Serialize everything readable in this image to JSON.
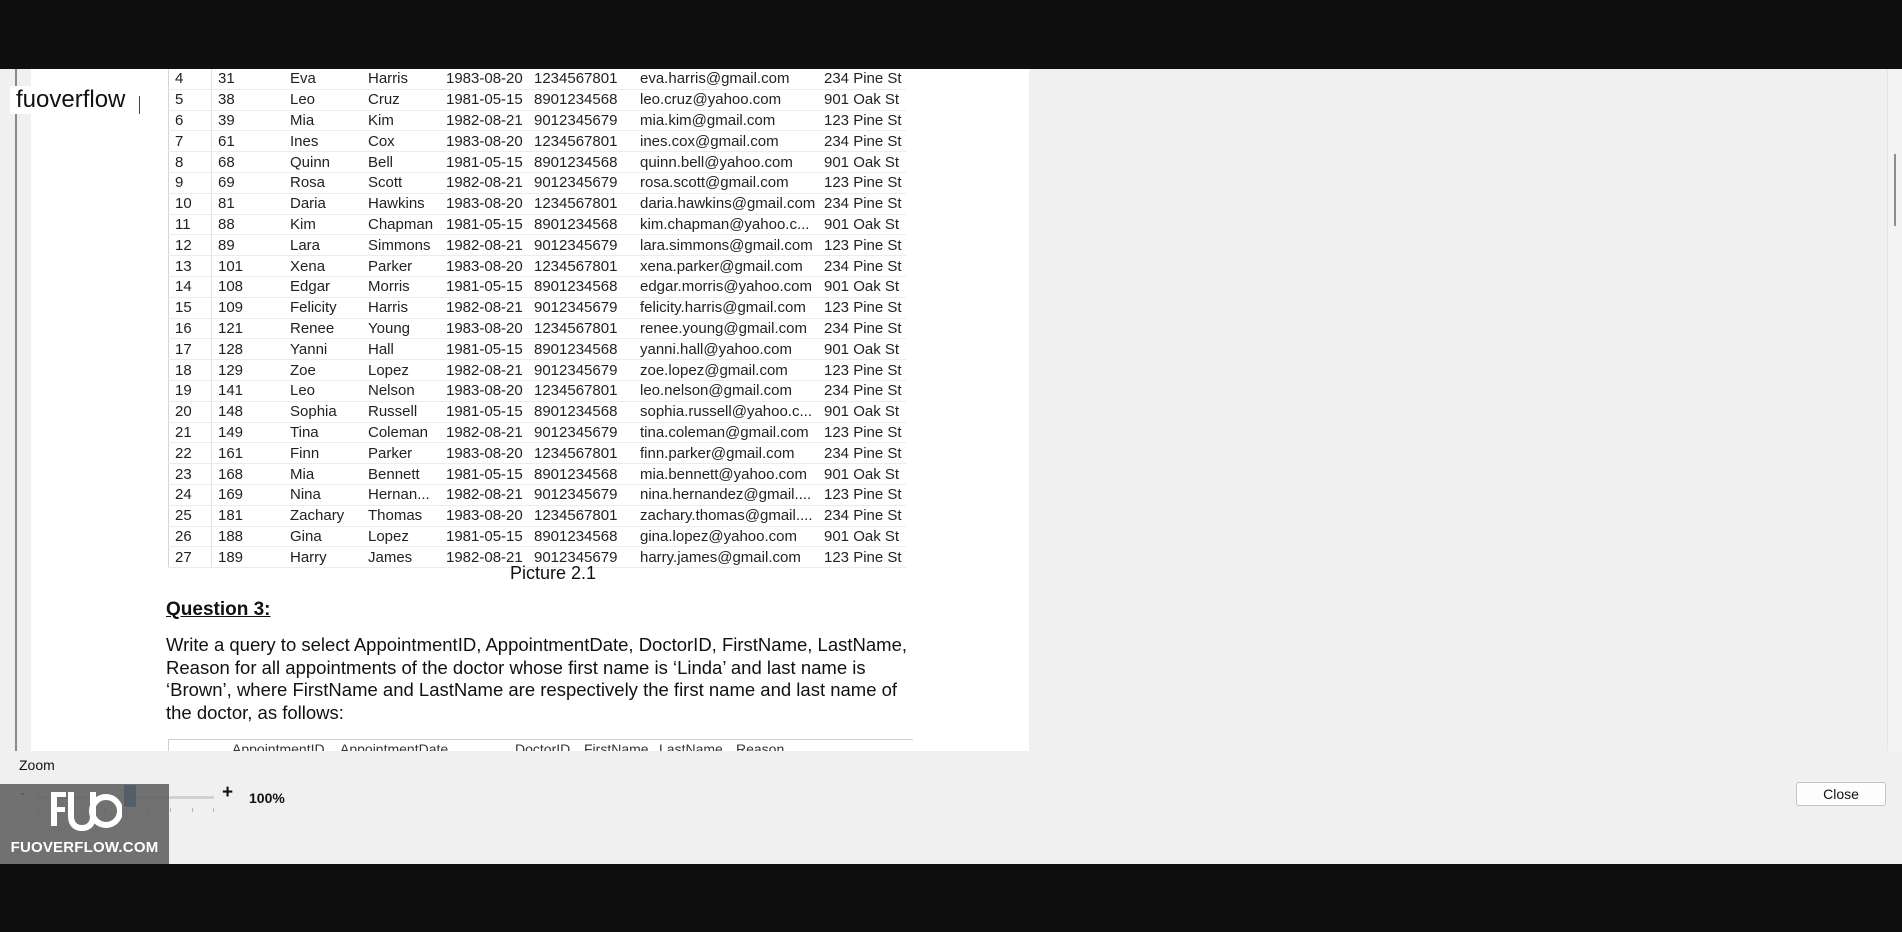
{
  "overlay_text": "fuoverflow",
  "table_rows": [
    [
      "4",
      "31",
      "Eva",
      "Harris",
      "1983-08-20",
      "1234567801",
      "eva.harris@gmail.com",
      "234 Pine St"
    ],
    [
      "5",
      "38",
      "Leo",
      "Cruz",
      "1981-05-15",
      "8901234568",
      "leo.cruz@yahoo.com",
      "901 Oak St"
    ],
    [
      "6",
      "39",
      "Mia",
      "Kim",
      "1982-08-21",
      "9012345679",
      "mia.kim@gmail.com",
      "123 Pine St"
    ],
    [
      "7",
      "61",
      "Ines",
      "Cox",
      "1983-08-20",
      "1234567801",
      "ines.cox@gmail.com",
      "234 Pine St"
    ],
    [
      "8",
      "68",
      "Quinn",
      "Bell",
      "1981-05-15",
      "8901234568",
      "quinn.bell@yahoo.com",
      "901 Oak St"
    ],
    [
      "9",
      "69",
      "Rosa",
      "Scott",
      "1982-08-21",
      "9012345679",
      "rosa.scott@gmail.com",
      "123 Pine St"
    ],
    [
      "10",
      "81",
      "Daria",
      "Hawkins",
      "1983-08-20",
      "1234567801",
      "daria.hawkins@gmail.com",
      "234 Pine St"
    ],
    [
      "11",
      "88",
      "Kim",
      "Chapman",
      "1981-05-15",
      "8901234568",
      "kim.chapman@yahoo.c...",
      "901 Oak St"
    ],
    [
      "12",
      "89",
      "Lara",
      "Simmons",
      "1982-08-21",
      "9012345679",
      "lara.simmons@gmail.com",
      "123 Pine St"
    ],
    [
      "13",
      "101",
      "Xena",
      "Parker",
      "1983-08-20",
      "1234567801",
      "xena.parker@gmail.com",
      "234 Pine St"
    ],
    [
      "14",
      "108",
      "Edgar",
      "Morris",
      "1981-05-15",
      "8901234568",
      "edgar.morris@yahoo.com",
      "901 Oak St"
    ],
    [
      "15",
      "109",
      "Felicity",
      "Harris",
      "1982-08-21",
      "9012345679",
      "felicity.harris@gmail.com",
      "123 Pine St"
    ],
    [
      "16",
      "121",
      "Renee",
      "Young",
      "1983-08-20",
      "1234567801",
      "renee.young@gmail.com",
      "234 Pine St"
    ],
    [
      "17",
      "128",
      "Yanni",
      "Hall",
      "1981-05-15",
      "8901234568",
      "yanni.hall@yahoo.com",
      "901 Oak St"
    ],
    [
      "18",
      "129",
      "Zoe",
      "Lopez",
      "1982-08-21",
      "9012345679",
      "zoe.lopez@gmail.com",
      "123 Pine St"
    ],
    [
      "19",
      "141",
      "Leo",
      "Nelson",
      "1983-08-20",
      "1234567801",
      "leo.nelson@gmail.com",
      "234 Pine St"
    ],
    [
      "20",
      "148",
      "Sophia",
      "Russell",
      "1981-05-15",
      "8901234568",
      "sophia.russell@yahoo.c...",
      "901 Oak St"
    ],
    [
      "21",
      "149",
      "Tina",
      "Coleman",
      "1982-08-21",
      "9012345679",
      "tina.coleman@gmail.com",
      "123 Pine St"
    ],
    [
      "22",
      "161",
      "Finn",
      "Parker",
      "1983-08-20",
      "1234567801",
      "finn.parker@gmail.com",
      "234 Pine St"
    ],
    [
      "23",
      "168",
      "Mia",
      "Bennett",
      "1981-05-15",
      "8901234568",
      "mia.bennett@yahoo.com",
      "901 Oak St"
    ],
    [
      "24",
      "169",
      "Nina",
      "Hernan...",
      "1982-08-21",
      "9012345679",
      "nina.hernandez@gmail....",
      "123 Pine St"
    ],
    [
      "25",
      "181",
      "Zachary",
      "Thomas",
      "1983-08-20",
      "1234567801",
      "zachary.thomas@gmail....",
      "234 Pine St"
    ],
    [
      "26",
      "188",
      "Gina",
      "Lopez",
      "1981-05-15",
      "8901234568",
      "gina.lopez@yahoo.com",
      "901 Oak St"
    ],
    [
      "27",
      "189",
      "Harry",
      "James",
      "1982-08-21",
      "9012345679",
      "harry.james@gmail.com",
      "123 Pine St"
    ]
  ],
  "caption": "Picture 2.1",
  "question": {
    "title": "Question 3:",
    "body": "Write a query to select AppointmentID, AppointmentDate, DoctorID, FirstName, LastName, Reason for all appointments of the doctor whose first name is ‘Linda’ and last name is ‘Brown’, where FirstName and LastName are respectively the first name and last name of the doctor, as follows:"
  },
  "next_table_headers": [
    "AppointmentID",
    "AppointmentDate",
    "DoctorID",
    "FirstName",
    "LastName",
    "Reason"
  ],
  "zoom": {
    "label": "Zoom",
    "minus": "-",
    "plus": "+",
    "value_text": "100%",
    "level_percent": 100
  },
  "close_label": "Close",
  "logo": {
    "mark": "FUO",
    "brand": "FUOVERFLOW.COM"
  }
}
